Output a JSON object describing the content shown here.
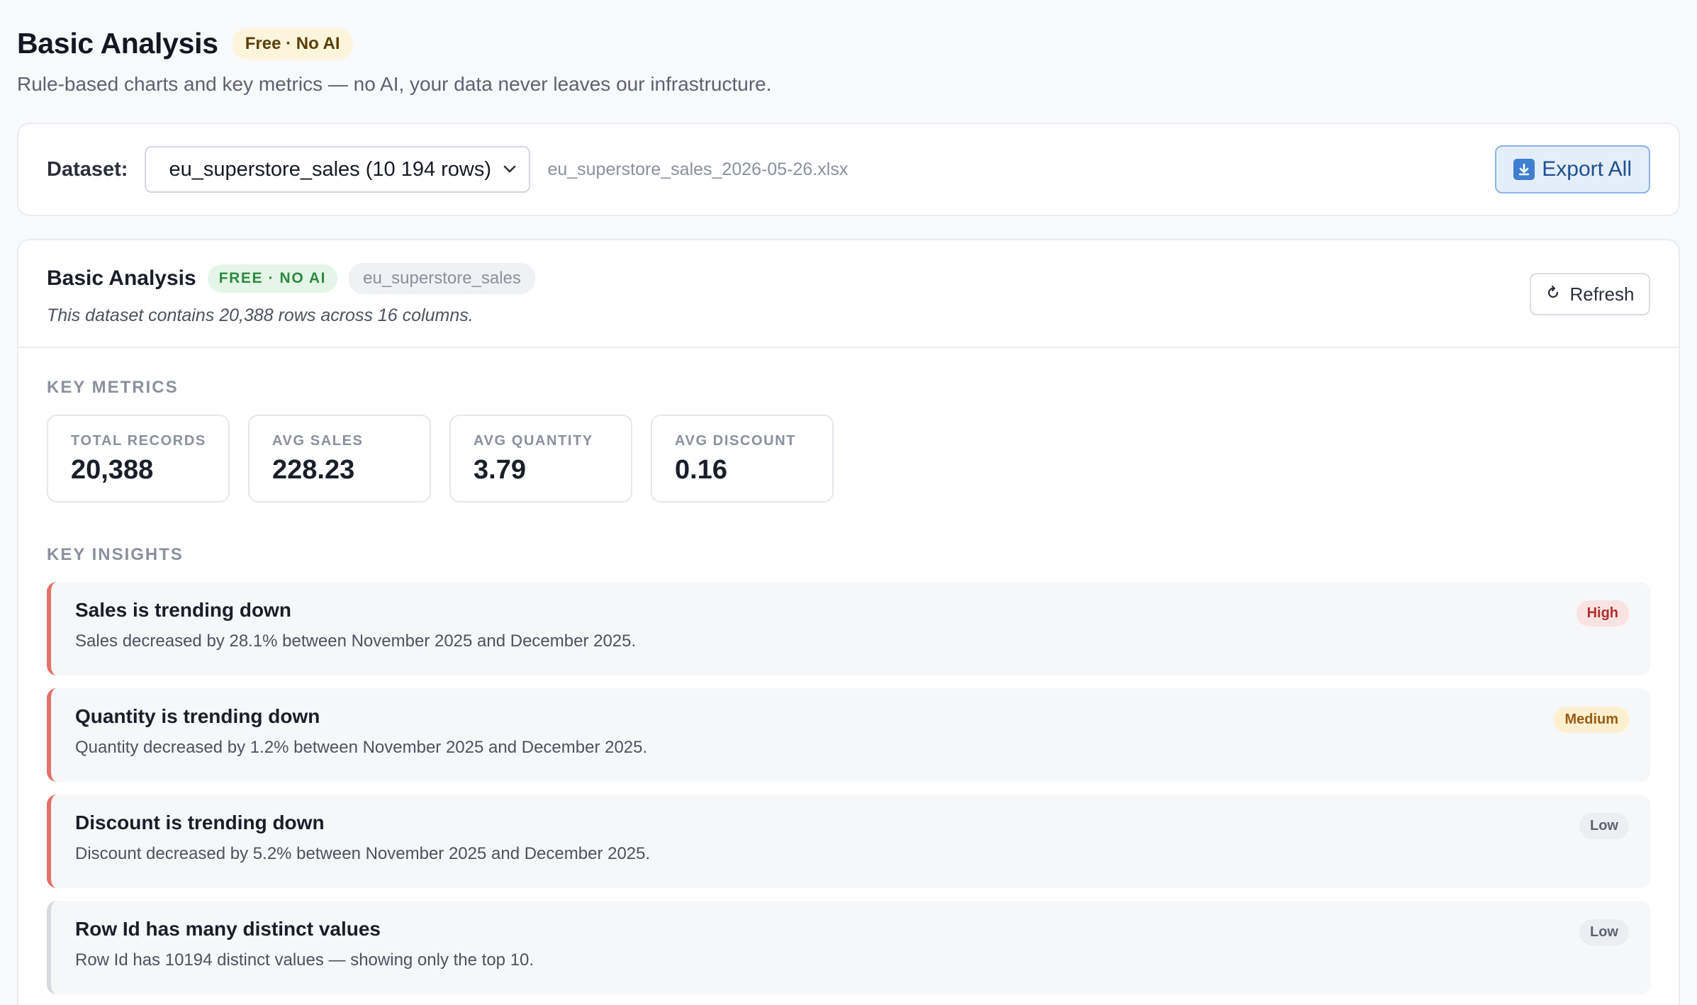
{
  "header": {
    "title": "Basic Analysis",
    "badge": "Free · No AI",
    "subtitle": "Rule-based charts and key metrics — no AI, your data never leaves our infrastructure."
  },
  "dataset_bar": {
    "label": "Dataset:",
    "selected": "eu_superstore_sales (10 194 rows)",
    "file_name": "eu_superstore_sales_2026-05-26.xlsx",
    "export_label": "Export All",
    "export_icon": "download-icon"
  },
  "analysis": {
    "title": "Basic Analysis",
    "badge": "FREE · NO AI",
    "dataset_chip": "eu_superstore_sales",
    "description": "This dataset contains 20,388 rows across 16 columns.",
    "refresh_label": "Refresh",
    "refresh_icon": "refresh-icon"
  },
  "metrics": {
    "section_label": "KEY METRICS",
    "items": [
      {
        "label": "TOTAL RECORDS",
        "value": "20,388"
      },
      {
        "label": "AVG SALES",
        "value": "228.23"
      },
      {
        "label": "AVG QUANTITY",
        "value": "3.79"
      },
      {
        "label": "AVG DISCOUNT",
        "value": "0.16"
      }
    ]
  },
  "insights": {
    "section_label": "KEY INSIGHTS",
    "items": [
      {
        "title": "Sales is trending down",
        "description": "Sales decreased by 28.1% between November 2025 and December 2025.",
        "severity": "High"
      },
      {
        "title": "Quantity is trending down",
        "description": "Quantity decreased by 1.2% between November 2025 and December 2025.",
        "severity": "Medium"
      },
      {
        "title": "Discount is trending down",
        "description": "Discount decreased by 5.2% between November 2025 and December 2025.",
        "severity": "Low"
      },
      {
        "title": "Row Id has many distinct values",
        "description": "Row Id has 10194 distinct values — showing only the top 10.",
        "severity": "Low"
      }
    ]
  },
  "colors": {
    "accent_blue": "#3f7fcf",
    "trend_down_border": "#e2716a",
    "high": "#b0302a",
    "medium": "#9a5b12",
    "low": "#5d6270",
    "free_green": "#2e8a3f"
  }
}
